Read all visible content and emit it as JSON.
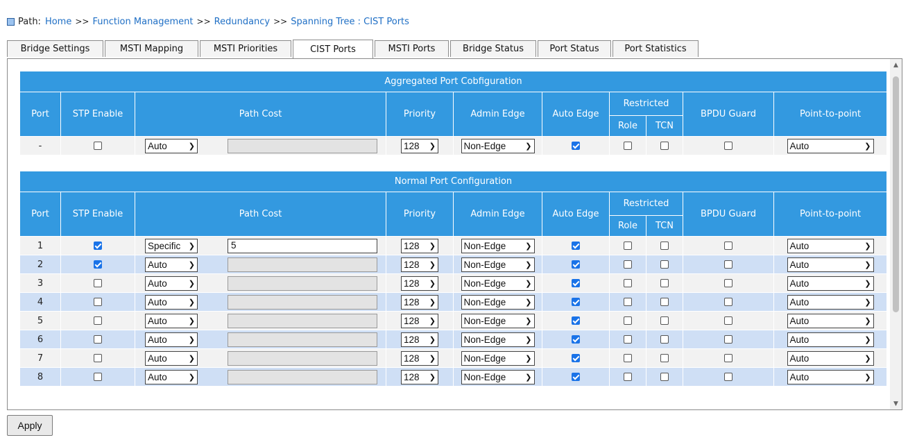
{
  "breadcrumb": {
    "label": "Path:",
    "items": [
      "Home",
      "Function Management",
      "Redundancy",
      "Spanning Tree : CIST Ports"
    ],
    "separator": ">>"
  },
  "tabs": [
    {
      "label": "Bridge Settings"
    },
    {
      "label": "MSTI Mapping"
    },
    {
      "label": "MSTI Priorities"
    },
    {
      "label": "CIST Ports",
      "active": true
    },
    {
      "label": "MSTI Ports"
    },
    {
      "label": "Bridge Status"
    },
    {
      "label": "Port Status"
    },
    {
      "label": "Port Statistics"
    }
  ],
  "headers": {
    "port": "Port",
    "stp_enable": "STP Enable",
    "path_cost": "Path Cost",
    "priority": "Priority",
    "admin_edge": "Admin Edge",
    "auto_edge": "Auto Edge",
    "restricted": "Restricted",
    "role": "Role",
    "tcn": "TCN",
    "bpdu_guard": "BPDU Guard",
    "point_to_point": "Point-to-point"
  },
  "aggregated": {
    "title": "Aggregated Port Cobfiguration",
    "row": {
      "port": "-",
      "stp_enable": false,
      "path_cost_mode": "Auto",
      "path_cost_value": "",
      "priority": "128",
      "admin_edge": "Non-Edge",
      "auto_edge": true,
      "role": false,
      "tcn": false,
      "bpdu_guard": false,
      "point_to_point": "Auto"
    }
  },
  "normal": {
    "title": "Normal Port Configuration",
    "rows": [
      {
        "port": "1",
        "stp_enable": true,
        "path_cost_mode": "Specific",
        "path_cost_value": "5",
        "priority": "128",
        "admin_edge": "Non-Edge",
        "auto_edge": true,
        "role": false,
        "tcn": false,
        "bpdu_guard": false,
        "point_to_point": "Auto"
      },
      {
        "port": "2",
        "stp_enable": true,
        "path_cost_mode": "Auto",
        "path_cost_value": "",
        "priority": "128",
        "admin_edge": "Non-Edge",
        "auto_edge": true,
        "role": false,
        "tcn": false,
        "bpdu_guard": false,
        "point_to_point": "Auto"
      },
      {
        "port": "3",
        "stp_enable": false,
        "path_cost_mode": "Auto",
        "path_cost_value": "",
        "priority": "128",
        "admin_edge": "Non-Edge",
        "auto_edge": true,
        "role": false,
        "tcn": false,
        "bpdu_guard": false,
        "point_to_point": "Auto"
      },
      {
        "port": "4",
        "stp_enable": false,
        "path_cost_mode": "Auto",
        "path_cost_value": "",
        "priority": "128",
        "admin_edge": "Non-Edge",
        "auto_edge": true,
        "role": false,
        "tcn": false,
        "bpdu_guard": false,
        "point_to_point": "Auto"
      },
      {
        "port": "5",
        "stp_enable": false,
        "path_cost_mode": "Auto",
        "path_cost_value": "",
        "priority": "128",
        "admin_edge": "Non-Edge",
        "auto_edge": true,
        "role": false,
        "tcn": false,
        "bpdu_guard": false,
        "point_to_point": "Auto"
      },
      {
        "port": "6",
        "stp_enable": false,
        "path_cost_mode": "Auto",
        "path_cost_value": "",
        "priority": "128",
        "admin_edge": "Non-Edge",
        "auto_edge": true,
        "role": false,
        "tcn": false,
        "bpdu_guard": false,
        "point_to_point": "Auto"
      },
      {
        "port": "7",
        "stp_enable": false,
        "path_cost_mode": "Auto",
        "path_cost_value": "",
        "priority": "128",
        "admin_edge": "Non-Edge",
        "auto_edge": true,
        "role": false,
        "tcn": false,
        "bpdu_guard": false,
        "point_to_point": "Auto"
      },
      {
        "port": "8",
        "stp_enable": false,
        "path_cost_mode": "Auto",
        "path_cost_value": "",
        "priority": "128",
        "admin_edge": "Non-Edge",
        "auto_edge": true,
        "role": false,
        "tcn": false,
        "bpdu_guard": false,
        "point_to_point": "Auto"
      }
    ]
  },
  "apply_label": "Apply",
  "colors": {
    "header_bg": "#3399e0",
    "row_even": "#cfdff5",
    "row_odd": "#f2f2f2",
    "link": "#1f6fc5",
    "checkbox_on": "#1a73e8"
  }
}
